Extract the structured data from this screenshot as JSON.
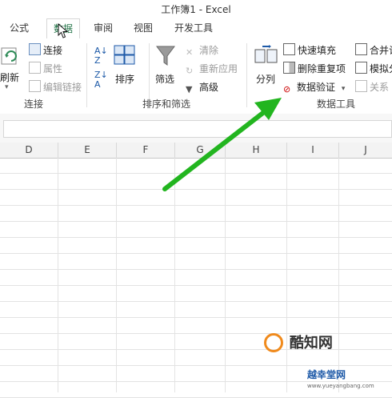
{
  "window": {
    "title": "工作簿1 - Excel"
  },
  "tabs": [
    {
      "label": "公式"
    },
    {
      "label": "数据"
    },
    {
      "label": "审阅"
    },
    {
      "label": "视图"
    },
    {
      "label": "开发工具"
    }
  ],
  "ribbon": {
    "connections": {
      "refresh_label": "刷新",
      "connect_label": "连接",
      "properties_label": "属性",
      "edit_links_label": "编辑链接",
      "group_label": "连接"
    },
    "sort_filter": {
      "sort_label": "排序",
      "filter_label": "筛选",
      "clear_label": "清除",
      "reapply_label": "重新应用",
      "advanced_label": "高级",
      "group_label": "排序和筛选"
    },
    "data_tools": {
      "text_to_columns_label": "分列",
      "flash_fill_label": "快速填充",
      "remove_duplicates_label": "删除重复项",
      "data_validation_label": "数据验证",
      "consolidate_label": "合并计",
      "what_if_label": "模拟分",
      "relationships_label": "关系",
      "group_label": "数据工具"
    }
  },
  "columns": [
    "D",
    "E",
    "F",
    "G",
    "H",
    "I",
    "J"
  ],
  "watermark": {
    "brand": "酷知网",
    "site_name": "越幸堂网",
    "url": "www.yueyangbang.com"
  },
  "colors": {
    "accent": "#217346",
    "arrow": "#22b51f"
  },
  "icons": [
    "cursor-icon",
    "green-arrow-icon"
  ]
}
